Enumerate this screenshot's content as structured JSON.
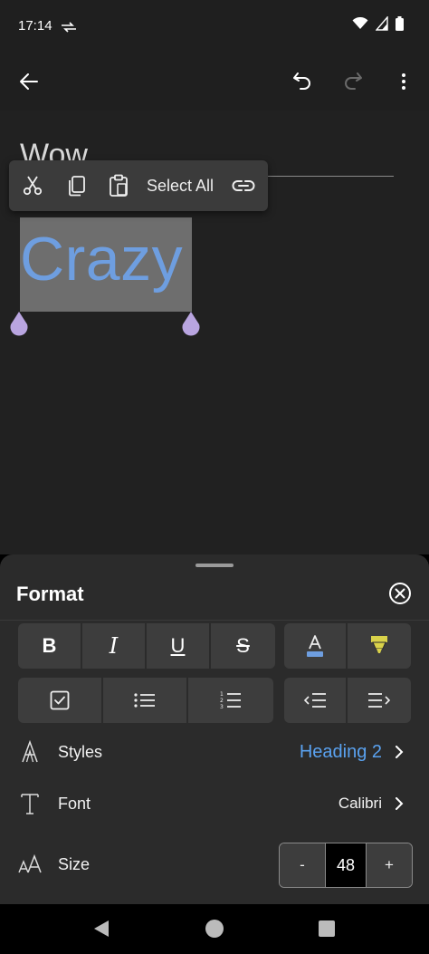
{
  "status_bar": {
    "time": "17:14"
  },
  "app_bar": {
    "icons": [
      "back-arrow-icon",
      "undo-icon",
      "redo-icon",
      "more-vert-icon"
    ]
  },
  "document": {
    "heading_text": "Wow",
    "selected_text": "Crazy",
    "colors": {
      "selected_text": "#6e9ee0",
      "selection_handle": "#b9a5e0"
    }
  },
  "context_menu": {
    "select_all_label": "Select All",
    "icons": [
      "cut-icon",
      "copy-icon",
      "paste-icon",
      "link-icon"
    ]
  },
  "format_sheet": {
    "title": "Format",
    "text_buttons": [
      "bold-icon",
      "italic-icon",
      "underline-icon",
      "strikethrough-icon"
    ],
    "color_buttons": [
      "font-color-icon",
      "highlight-icon"
    ],
    "list_buttons": [
      "checklist-icon",
      "bullet-list-icon",
      "numbered-list-icon"
    ],
    "indent_buttons": [
      "decrease-indent-icon",
      "increase-indent-icon"
    ],
    "bold_glyph": "B",
    "italic_glyph": "I",
    "underline_glyph": "U",
    "strike_glyph": "S",
    "styles": {
      "label": "Styles",
      "value": "Heading 2"
    },
    "font": {
      "label": "Font",
      "value": "Calibri"
    },
    "size": {
      "label": "Size",
      "value": "48",
      "minus_label": "-",
      "plus_label": "+"
    },
    "colors": {
      "accent": "#5aa2f0",
      "highlight": "#d9d24a",
      "font_color_bar": "#6e9ee0"
    }
  }
}
